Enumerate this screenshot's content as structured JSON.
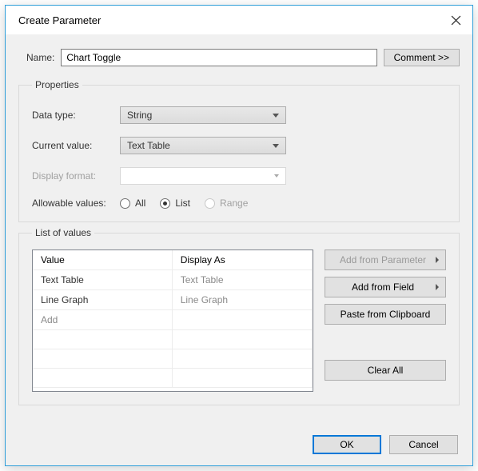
{
  "dialog": {
    "title": "Create Parameter"
  },
  "name_row": {
    "label": "Name:",
    "value": "Chart Toggle",
    "comment_btn": "Comment >>"
  },
  "properties": {
    "legend": "Properties",
    "data_type_label": "Data type:",
    "data_type_value": "String",
    "current_value_label": "Current value:",
    "current_value_value": "Text Table",
    "display_format_label": "Display format:",
    "display_format_value": "",
    "allowable_label": "Allowable values:",
    "option_all": "All",
    "option_list": "List",
    "option_range": "Range"
  },
  "list_of_values": {
    "legend": "List of values",
    "columns": {
      "value": "Value",
      "display": "Display As"
    },
    "rows": [
      {
        "value": "Text Table",
        "display": "Text Table"
      },
      {
        "value": "Line Graph",
        "display": "Line Graph"
      }
    ],
    "add_row": "Add",
    "buttons": {
      "add_from_parameter": "Add from Parameter",
      "add_from_field": "Add from Field",
      "paste": "Paste from Clipboard",
      "clear_all": "Clear All"
    }
  },
  "footer": {
    "ok": "OK",
    "cancel": "Cancel"
  }
}
